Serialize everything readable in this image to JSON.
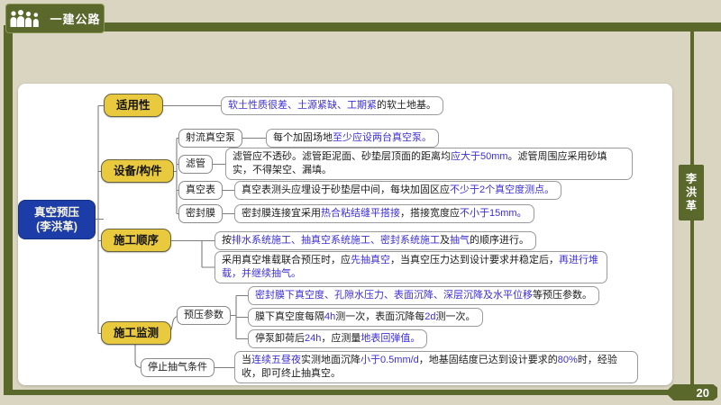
{
  "chrome": {
    "logo_text": "一建公路",
    "side_banner_text": "李洪革",
    "page_number": "20"
  },
  "colors": {
    "accent_green": "#5a682c",
    "background_beige": "#d9d5c1",
    "root_blue": "#1c3da8",
    "topic_yellow": "#e9c93e",
    "highlight_text_blue": "#3c2fd4",
    "body_text": "#1c1c1c"
  },
  "root": {
    "title_line1": "真空预压",
    "title_line2": "(李洪革)"
  },
  "branches": {
    "applicability": {
      "label": "适用性",
      "leaves": [
        [
          {
            "t": "软土性质很差、土源紧缺、工期紧",
            "hl": true
          },
          {
            "t": "的软土地基。"
          }
        ]
      ]
    },
    "equipment": {
      "label": "设备/构件",
      "children": {
        "jet_pump": {
          "label": "射流真空泵",
          "leaves": [
            [
              {
                "t": "每个加固场地"
              },
              {
                "t": "至少应设两台真空泵。",
                "hl": true
              }
            ]
          ]
        },
        "filter_pipe": {
          "label": "滤管",
          "leaves": [
            [
              {
                "t": "滤管应不透砂。滤管距泥面、砂垫层顶面的距离均"
              },
              {
                "t": "应大于50mm",
                "hl": true
              },
              {
                "t": "。滤管周围应采用砂填实，不得架空、漏填。"
              }
            ]
          ]
        },
        "vacuum_gauge": {
          "label": "真空表",
          "leaves": [
            [
              {
                "t": "真空表测头应埋设于砂垫层中间，每块加固区应"
              },
              {
                "t": "不少于2个真空度测点。",
                "hl": true
              }
            ]
          ]
        },
        "sealing_membrane": {
          "label": "密封膜",
          "leaves": [
            [
              {
                "t": "密封膜连接宜采用"
              },
              {
                "t": "热合粘结缝平搭接",
                "hl": true
              },
              {
                "t": "，搭接宽度应"
              },
              {
                "t": "不小于15mm。",
                "hl": true
              }
            ]
          ]
        }
      }
    },
    "sequence": {
      "label": "施工顺序",
      "leaves": [
        [
          {
            "t": "按"
          },
          {
            "t": "排水系统施工、抽真空系统施工、密封系统施工",
            "hl": true
          },
          {
            "t": "及"
          },
          {
            "t": "抽气",
            "hl": true
          },
          {
            "t": "的顺序进行。"
          }
        ],
        [
          {
            "t": "采用真空堆载联合预压时，应"
          },
          {
            "t": "先抽真空",
            "hl": true
          },
          {
            "t": "，当真空压力达到设计要求并稳定后，"
          },
          {
            "t": "再进行堆载，并继续抽气。",
            "hl": true
          }
        ]
      ]
    },
    "monitoring": {
      "label": "施工监测",
      "children": {
        "preload_params": {
          "label": "预压参数",
          "leaves": [
            [
              {
                "t": "密封膜下真空度、孔隙水压力、表面沉降、深层沉降及水平位移",
                "hl": true
              },
              {
                "t": "等预压参数。"
              }
            ],
            [
              {
                "t": "膜下真空度每隔"
              },
              {
                "t": "4h",
                "hl": true
              },
              {
                "t": "测一次，表面沉降每"
              },
              {
                "t": "2d",
                "hl": true
              },
              {
                "t": "测一次。"
              }
            ],
            [
              {
                "t": "停泵卸荷后"
              },
              {
                "t": "24h",
                "hl": true
              },
              {
                "t": "，应测量"
              },
              {
                "t": "地表回弹值。",
                "hl": true
              }
            ]
          ]
        },
        "stop_condition": {
          "label": "停止抽气条件",
          "leaves": [
            [
              {
                "t": "当"
              },
              {
                "t": "连续五昼夜",
                "hl": true
              },
              {
                "t": "实测地面沉降"
              },
              {
                "t": "小于0.5mm/d",
                "hl": true
              },
              {
                "t": "，地基固结度已达到设计要求的"
              },
              {
                "t": "80%",
                "hl": true
              },
              {
                "t": "时，经验收，即可终止抽真空。"
              }
            ]
          ]
        }
      }
    }
  }
}
